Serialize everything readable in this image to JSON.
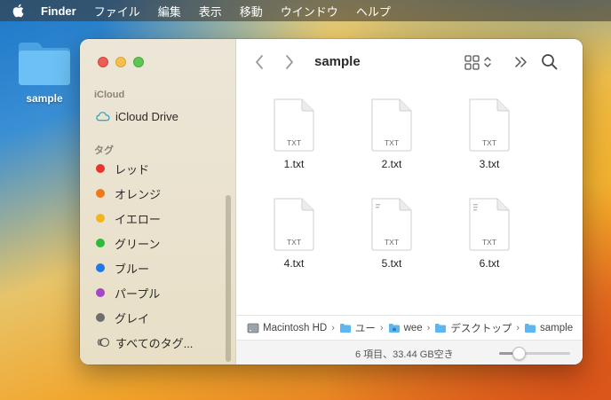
{
  "menubar": {
    "apple_icon": "apple-logo-icon",
    "items": [
      "Finder",
      "ファイル",
      "編集",
      "表示",
      "移動",
      "ウインドウ",
      "ヘルプ"
    ]
  },
  "desktop": {
    "folder_label": "sample"
  },
  "window": {
    "title": "sample",
    "sidebar": {
      "icloud_header": "iCloud",
      "icloud_drive": "iCloud Drive",
      "tags_header": "タグ",
      "tags": [
        {
          "label": "レッド",
          "color": "#e8342d"
        },
        {
          "label": "オレンジ",
          "color": "#f07a1a"
        },
        {
          "label": "イエロー",
          "color": "#f2b51c"
        },
        {
          "label": "グリーン",
          "color": "#2dbb3c"
        },
        {
          "label": "ブルー",
          "color": "#1e78e6"
        },
        {
          "label": "パープル",
          "color": "#a546c7"
        },
        {
          "label": "グレイ",
          "color": "#6e6e6e"
        }
      ],
      "all_tags": "すべてのタグ..."
    },
    "files": [
      {
        "name": "1.txt",
        "type_label": "TXT"
      },
      {
        "name": "2.txt",
        "type_label": "TXT"
      },
      {
        "name": "3.txt",
        "type_label": "TXT"
      },
      {
        "name": "4.txt",
        "type_label": "TXT"
      },
      {
        "name": "5.txt",
        "type_label": "TXT"
      },
      {
        "name": "6.txt",
        "type_label": "TXT"
      }
    ],
    "pathbar": [
      "Macintosh HD",
      "ユー",
      "wee",
      "デスクトップ",
      "sample"
    ],
    "status": "6 項目、33.44 GB空き",
    "icon_size_slider": 0.28
  },
  "colors": {
    "folder_blue": "#5eb6f0",
    "icloud_teal": "#3aa6b9"
  }
}
